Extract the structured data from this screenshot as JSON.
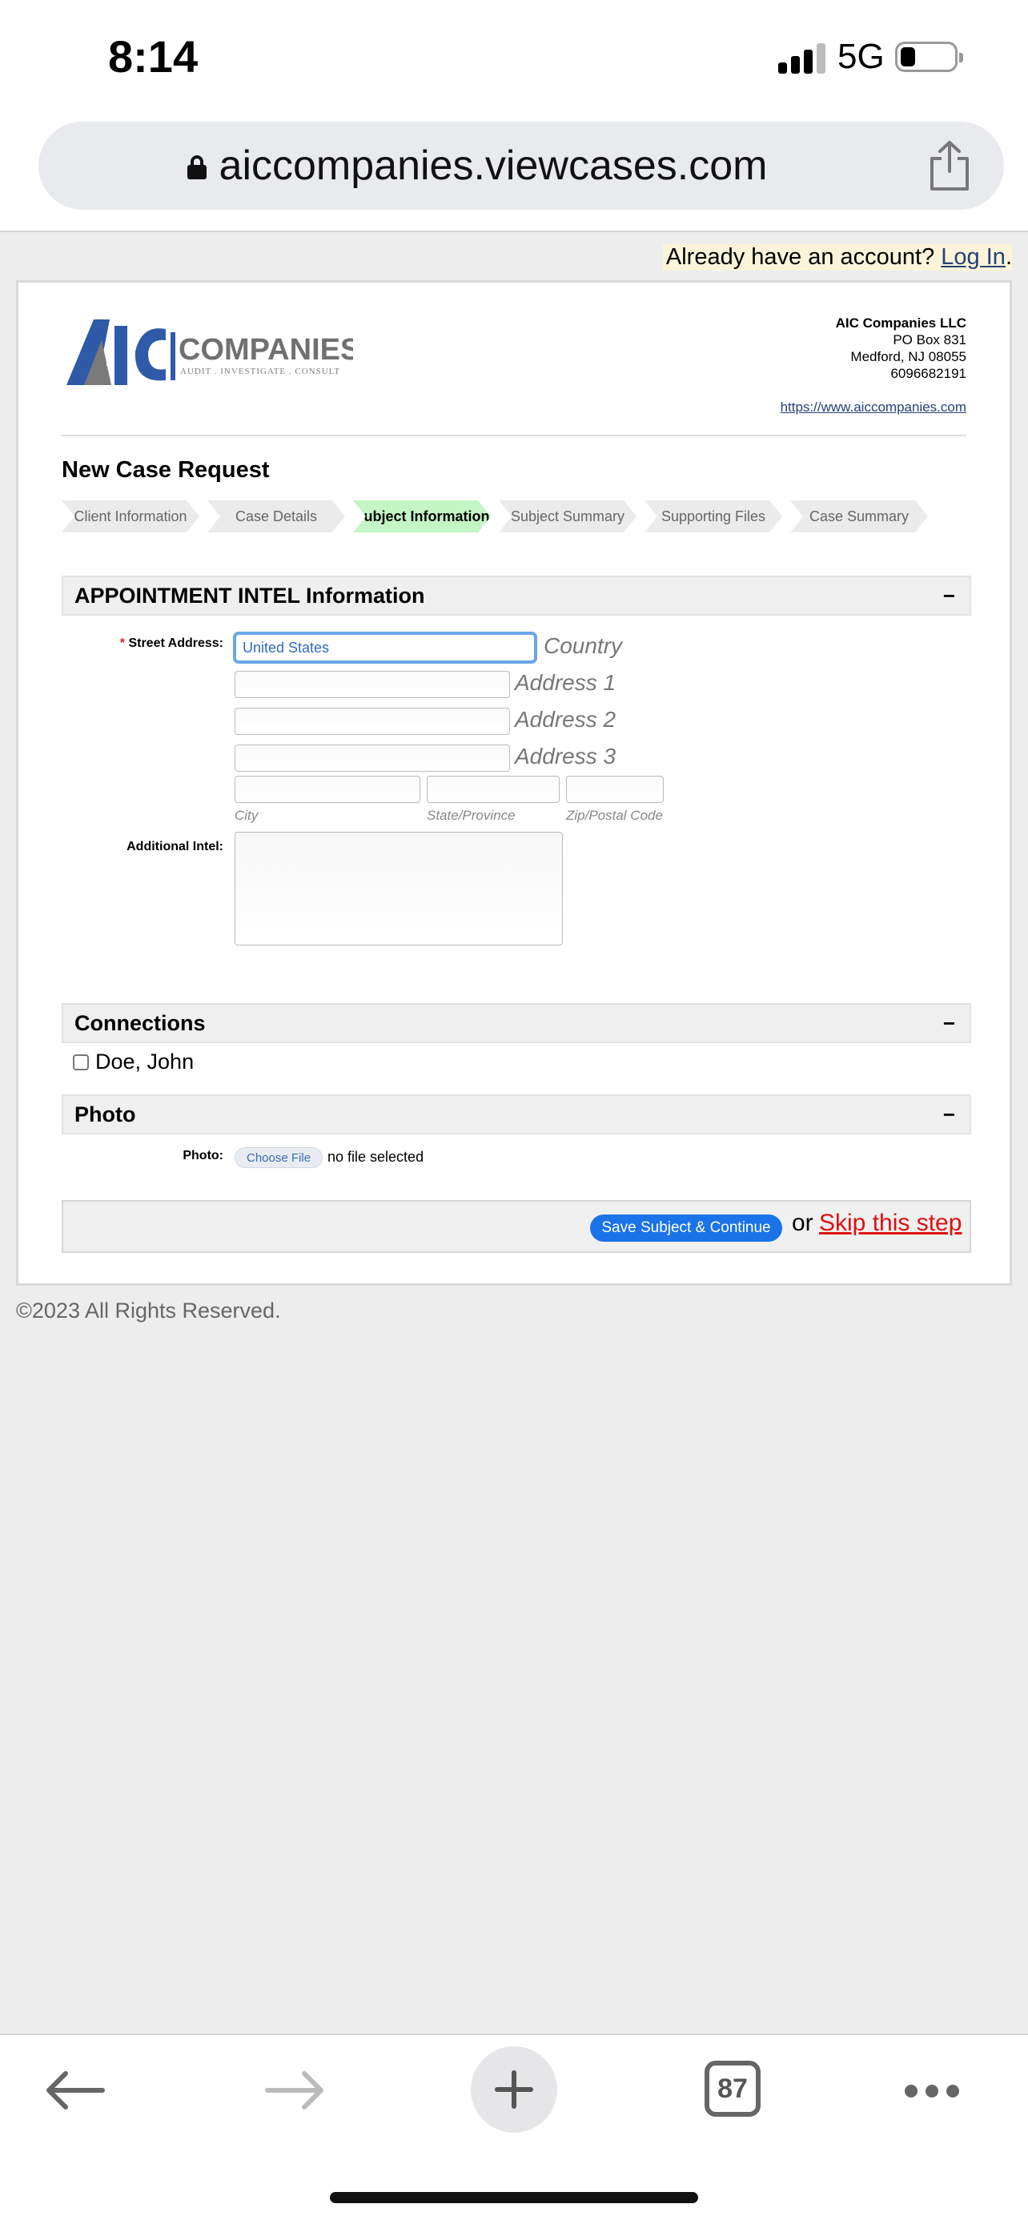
{
  "status_bar": {
    "time": "8:14",
    "network": "5G"
  },
  "browser": {
    "url": "aiccompanies.viewcases.com",
    "tab_count": "87"
  },
  "login_note": {
    "prefix": "Already have an account? ",
    "link": "Log In",
    "suffix": "."
  },
  "company": {
    "logo_text": "COMPANIES",
    "logo_tagline": "AUDIT . INVESTIGATE . CONSULT",
    "name": "AIC Companies LLC",
    "address1": "PO Box 831",
    "address2": "Medford, NJ 08055",
    "phone": "6096682191",
    "website": "https://www.aiccompanies.com"
  },
  "page_title": "New Case Request",
  "steps": [
    {
      "label": "Client Information",
      "active": false
    },
    {
      "label": "Case Details",
      "active": false
    },
    {
      "label": "Subject Information",
      "active": true
    },
    {
      "label": "Subject Summary",
      "active": false
    },
    {
      "label": "Supporting Files",
      "active": false
    },
    {
      "label": "Case Summary",
      "active": false
    }
  ],
  "appointment_section": {
    "title": "APPOINTMENT INTEL Information",
    "collapse": "−",
    "street_label": "Street Address:",
    "required_mark": "*",
    "country_value": "United States",
    "country_hint": "Country",
    "address1_hint": "Address 1",
    "address2_hint": "Address 2",
    "address3_hint": "Address 3",
    "city_hint": "City",
    "state_hint": "State/Province",
    "zip_hint": "Zip/Postal Code",
    "additional_label": "Additional Intel:"
  },
  "connections_section": {
    "title": "Connections",
    "collapse": "−",
    "person": "Doe, John"
  },
  "photo_section": {
    "title": "Photo",
    "collapse": "−",
    "label": "Photo:",
    "button": "Choose File",
    "status": "no file selected"
  },
  "actions": {
    "save": "Save Subject & Continue",
    "or": "or",
    "skip": "Skip this step"
  },
  "footer": "©2023 All Rights Reserved.",
  "colors": {
    "active_step": "#c4f5c4",
    "primary_button": "#1a73e8",
    "skip_link": "#dd1111",
    "link": "#25417a"
  }
}
